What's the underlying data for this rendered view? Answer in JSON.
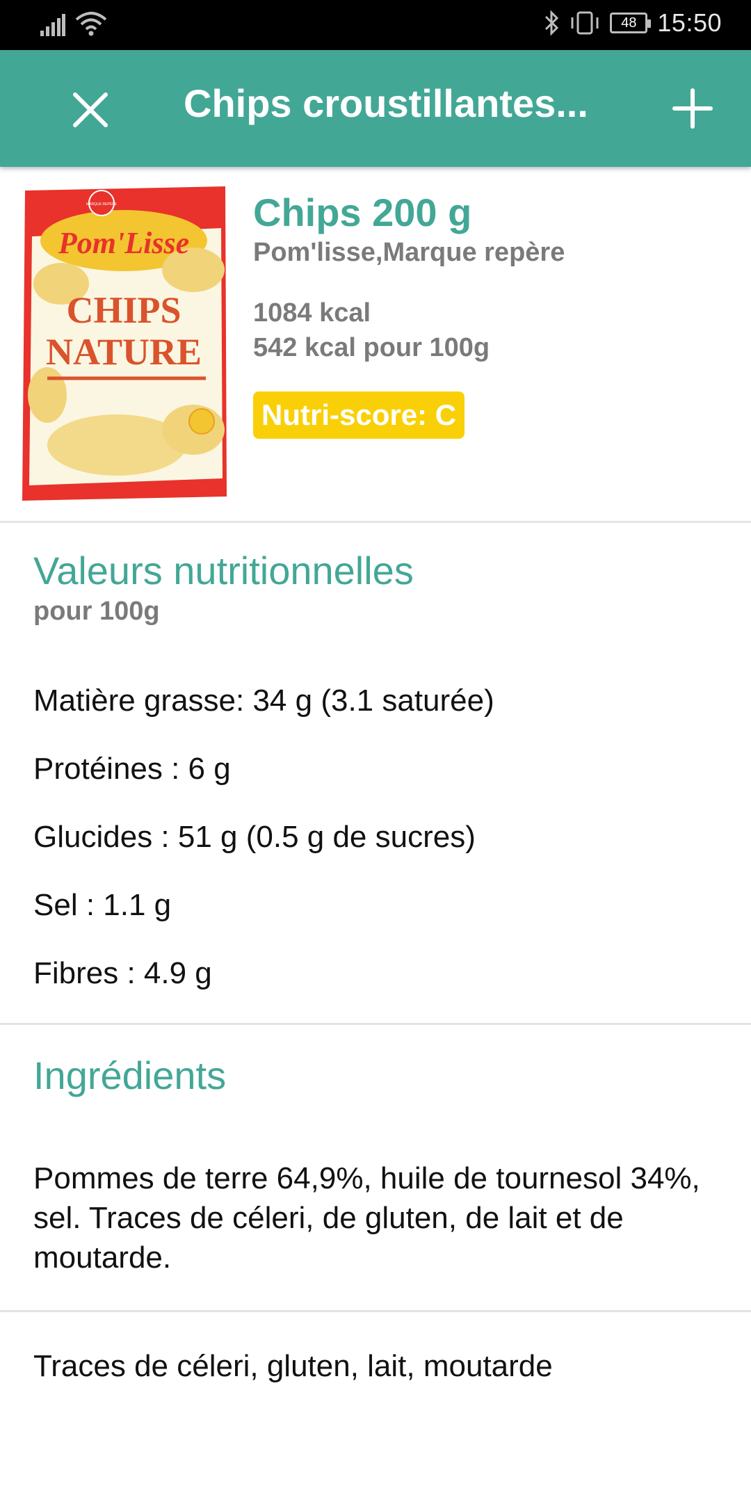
{
  "status_bar": {
    "time": "15:50",
    "battery": "48"
  },
  "app_bar": {
    "title": "Chips croustillantes..."
  },
  "product": {
    "name": "Chips 200 g",
    "brand": "Pom'lisse,Marque repère",
    "kcal_total": "1084 kcal",
    "kcal_per_100": "542 kcal pour 100g",
    "nutri_score": "Nutri-score: C",
    "image": {
      "brand_logo": "Pom'Lisse",
      "line1": "CHIPS",
      "line2": "NATURE",
      "seal": "MARQUE REPÈRE"
    }
  },
  "nutrition": {
    "title": "Valeurs nutritionnelles",
    "subtitle": "pour 100g",
    "items": [
      "Matière grasse: 34 g (3.1 saturée)",
      "Protéines : 6 g",
      "Glucides : 51 g (0.5 g de sucres)",
      "Sel : 1.1 g",
      "Fibres : 4.9 g"
    ]
  },
  "ingredients": {
    "title": "Ingrédients",
    "text": "Pommes de terre 64,9%, huile de tournesol 34%, sel. Traces de céleri, de gluten, de lait et de moutarde."
  },
  "traces": {
    "text": "Traces de céleri, gluten, lait, moutarde"
  },
  "colors": {
    "accent": "#43a796",
    "nutri_badge": "#f9d008",
    "secondary_text": "#7a7a7a"
  }
}
